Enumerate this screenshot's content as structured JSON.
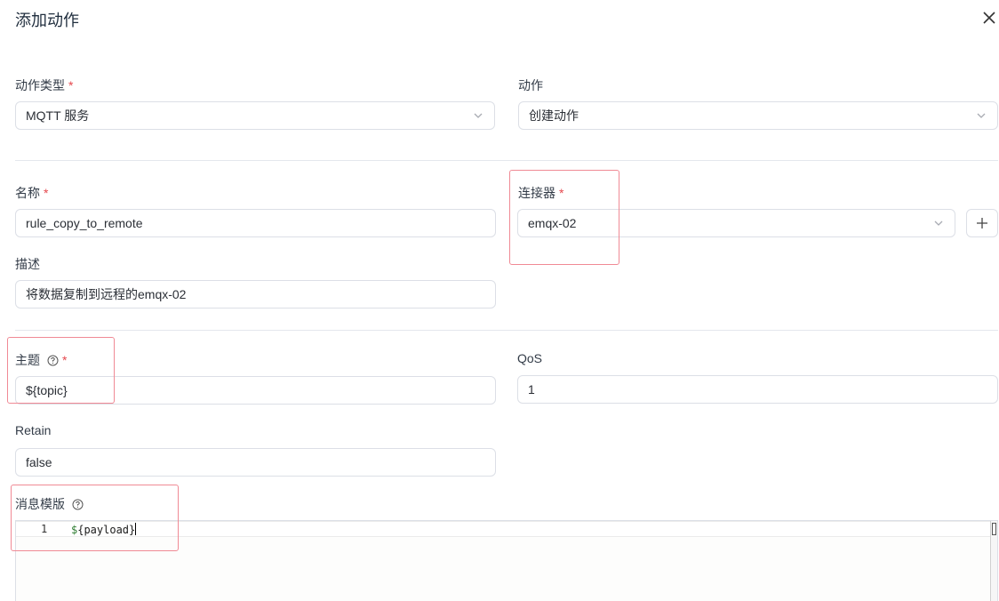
{
  "dialog": {
    "title": "添加动作"
  },
  "form": {
    "action_type": {
      "label": "动作类型",
      "required": "*",
      "value": "MQTT 服务"
    },
    "action": {
      "label": "动作",
      "value": "创建动作"
    },
    "name": {
      "label": "名称",
      "required": "*",
      "value": "rule_copy_to_remote"
    },
    "connector": {
      "label": "连接器",
      "required": "*",
      "value": "emqx-02"
    },
    "description": {
      "label": "描述",
      "value": "将数据复制到远程的emqx-02"
    },
    "topic": {
      "label": "主题",
      "required": "*",
      "value": "${topic}"
    },
    "qos": {
      "label": "QoS",
      "value": "1"
    },
    "retain": {
      "label": "Retain",
      "value": "false"
    },
    "payload_template": {
      "label": "消息模版",
      "line_number": "1",
      "code_prefix": "$",
      "code_body": "{payload}"
    }
  },
  "icons": {
    "close": "close-icon",
    "chevron": "chevron-down-icon",
    "plus": "plus-icon",
    "help": "question-circle-icon"
  },
  "colors": {
    "required": "#e5484d",
    "highlight_box": "#f08a95",
    "border": "#dcdfe6"
  }
}
